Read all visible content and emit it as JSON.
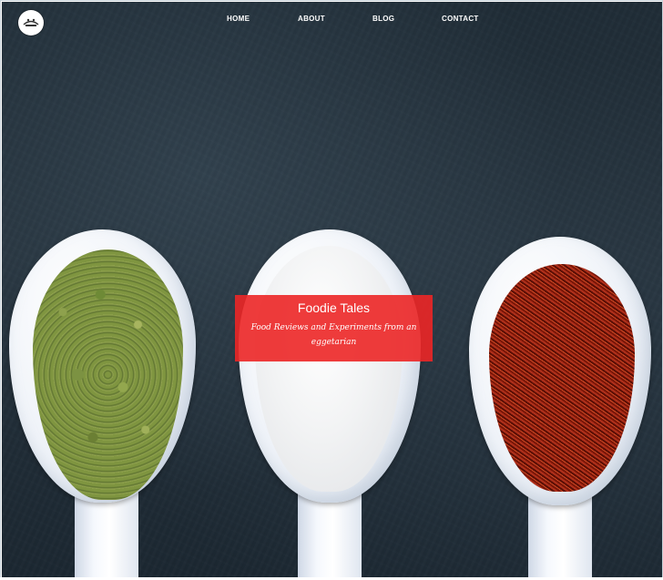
{
  "site": {
    "logo_icon": "site-logo-icon"
  },
  "nav": {
    "items": [
      {
        "label": "HOME"
      },
      {
        "label": "ABOUT"
      },
      {
        "label": "BLOG"
      },
      {
        "label": "CONTACT"
      }
    ]
  },
  "hero": {
    "title": "Foodie Tales",
    "subtitle": "Food Reviews and Experiments from an eggetarian",
    "banner_color": "#ec2626",
    "background_color": "#22303a",
    "spoons": [
      {
        "content": "thyme"
      },
      {
        "content": "salt"
      },
      {
        "content": "saffron"
      }
    ]
  }
}
